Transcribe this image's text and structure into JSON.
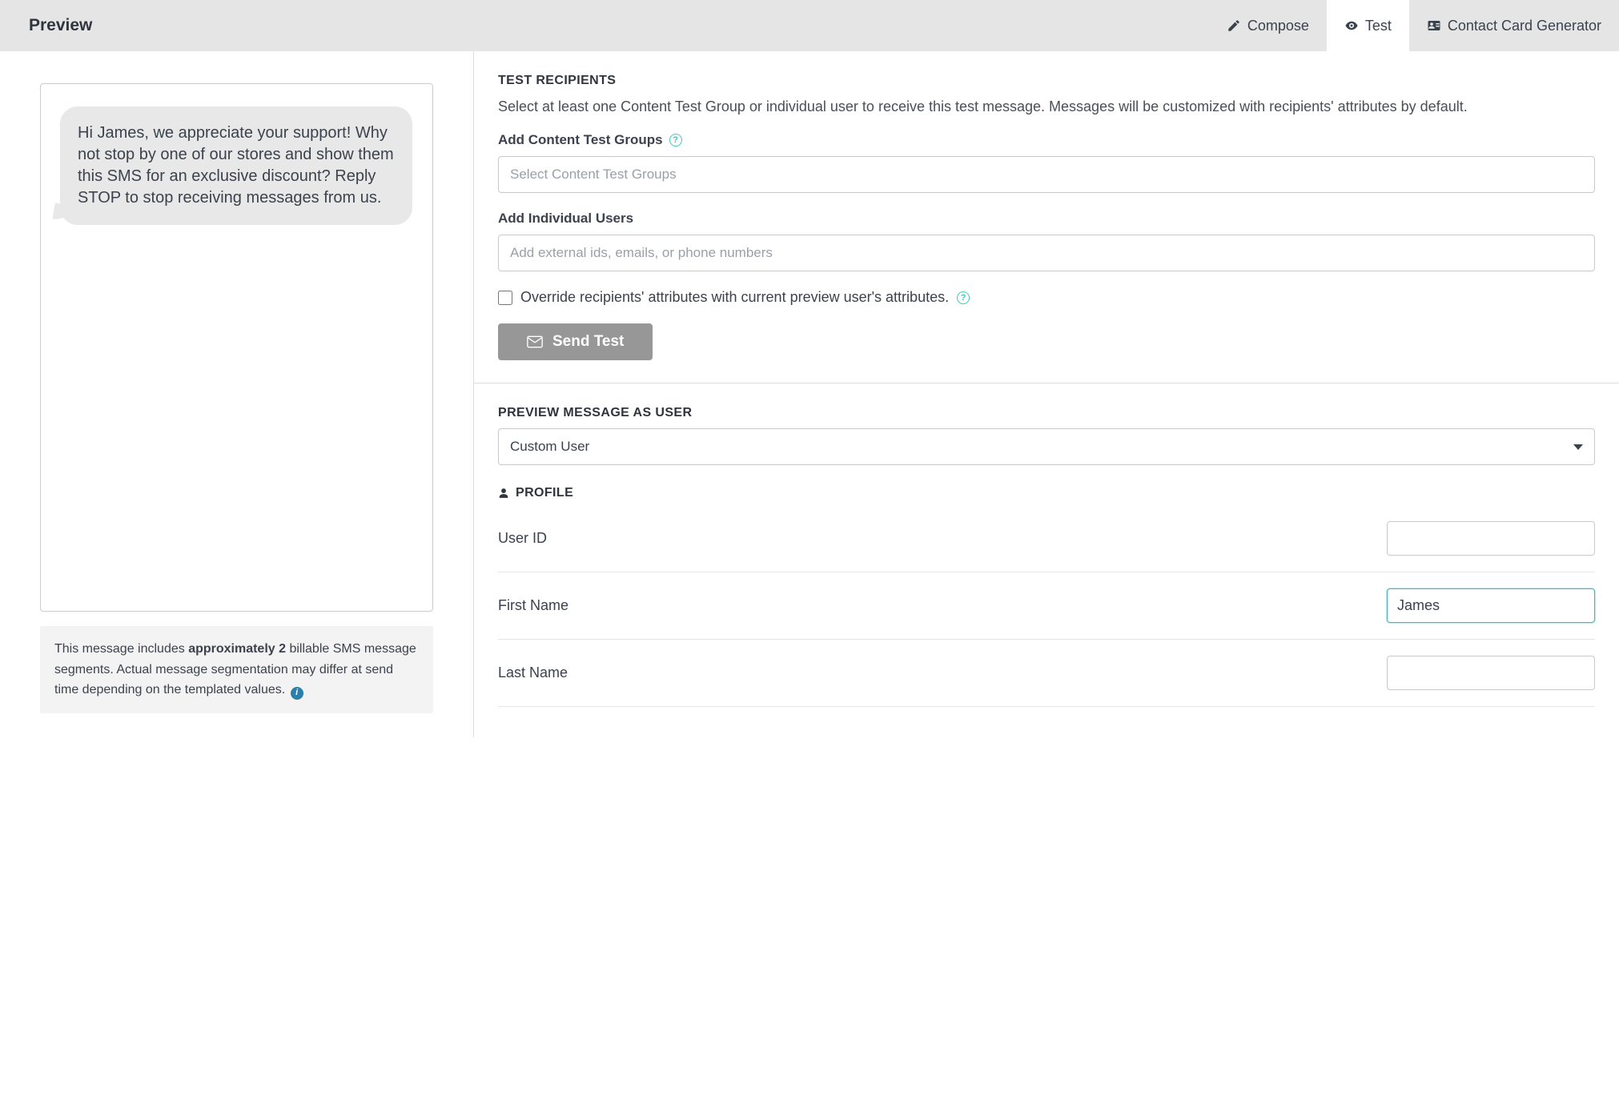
{
  "topbar": {
    "title": "Preview",
    "tabs": {
      "compose": "Compose",
      "test": "Test",
      "contact_card": "Contact Card Generator"
    }
  },
  "preview": {
    "bubble_text": "Hi James, we appreciate your support! Why not stop by one of our stores and show them this SMS for an exclusive discount? Reply STOP to stop receiving messages from us.",
    "segments_prefix": "This message includes ",
    "segments_bold": "approximately 2",
    "segments_suffix": " billable SMS message segments. Actual message segmentation may differ at send time depending on the templated values."
  },
  "test_recipients": {
    "heading": "TEST RECIPIENTS",
    "desc": "Select at least one Content Test Group or individual user to receive this test message. Messages will be customized with recipients' attributes by default.",
    "groups_label": "Add Content Test Groups",
    "groups_placeholder": "Select Content Test Groups",
    "users_label": "Add Individual Users",
    "users_placeholder": "Add external ids, emails, or phone numbers",
    "override_label": "Override recipients' attributes with current preview user's attributes.",
    "send_label": "Send Test"
  },
  "preview_as_user": {
    "heading": "PREVIEW MESSAGE AS USER",
    "selected": "Custom User",
    "profile_heading": "PROFILE",
    "fields": {
      "user_id": {
        "label": "User ID",
        "value": ""
      },
      "first_name": {
        "label": "First Name",
        "value": "James"
      },
      "last_name": {
        "label": "Last Name",
        "value": ""
      }
    }
  }
}
